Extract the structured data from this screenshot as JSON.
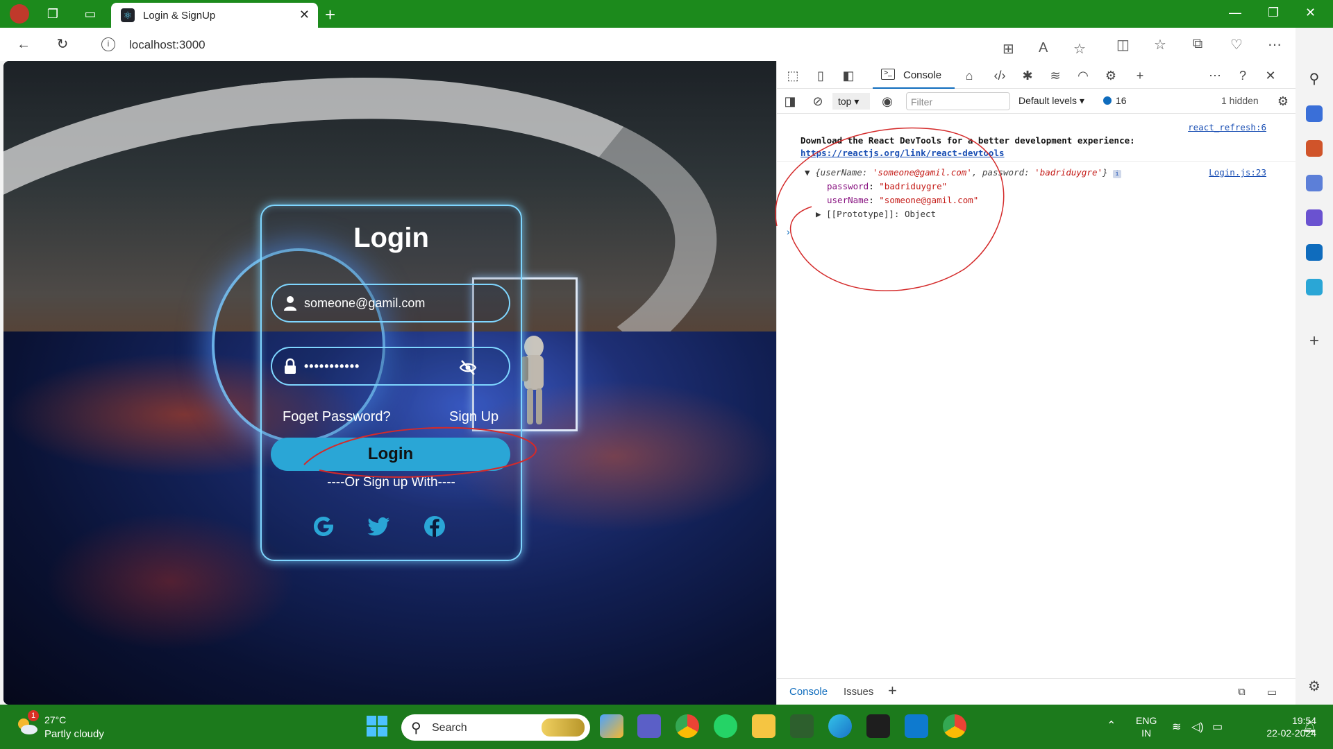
{
  "browser": {
    "tab_title": "Login & SignUp",
    "url": "localhost:3000"
  },
  "login": {
    "title": "Login",
    "username_value": "someone@gamil.com",
    "password_value": "•••••••••••",
    "forgot_label": "Foget Password?",
    "signup_label": "Sign Up",
    "button_label": "Login",
    "or_text": "----Or Sign up With----"
  },
  "devtools": {
    "console_tab": "Console",
    "context": "top",
    "filter_placeholder": "Filter",
    "levels": "Default levels",
    "message_count": "16",
    "hidden": "1 hidden",
    "msg1_source": "react_refresh:6",
    "msg1_text": "Download the React DevTools for a better development experience: ",
    "msg1_link": "https://reactjs.org/link/react-devtools",
    "obj_summary_open": "{",
    "obj_key1": "userName: ",
    "obj_val1": "'someone@gamil.com'",
    "obj_key2": ", password: ",
    "obj_val2": "'badriduygre'",
    "obj_summary_close": "}",
    "obj_source": "Login.js:23",
    "prop_password_key": "password",
    "prop_password_val": "\"badriduygre\"",
    "prop_username_key": "userName",
    "prop_username_val": "\"someone@gamil.com\"",
    "proto": "[[Prototype]]: Object",
    "drawer_console": "Console",
    "drawer_issues": "Issues"
  },
  "taskbar": {
    "temp": "27°C",
    "condition": "Partly cloudy",
    "weather_badge": "1",
    "search_label": "Search",
    "lang1": "ENG",
    "lang2": "IN",
    "time": "19:54",
    "date": "22-02-2024"
  },
  "colors": {
    "titlebar": "#1c8a1c",
    "taskbar": "#1c7a1c",
    "accent": "#0f6cbd",
    "login_button": "#2aa6d6",
    "card_border": "#7fd6ff"
  }
}
